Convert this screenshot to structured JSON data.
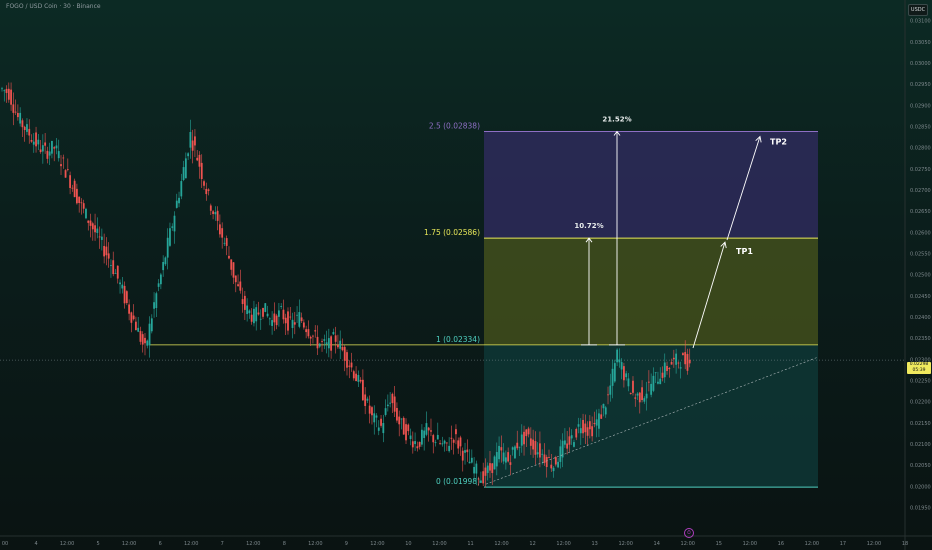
{
  "header": {
    "title": "FOGO / USD Coin · 30 · Binance"
  },
  "currency": "USDC",
  "current_price": {
    "value": "0.02298",
    "countdown": "05:39"
  },
  "colors": {
    "up": "#26a69a",
    "down": "#ef5350",
    "fib_top": "#8e6fc4",
    "fib_mid": "#e8e85a",
    "fib_base": "#4fd0c0",
    "zone_top": "#2e2a5a",
    "zone_mid": "#424f1c",
    "zone_low": "#0f3b3a"
  },
  "chart_data": {
    "type": "candlestick",
    "y_axis": {
      "ticks": [
        "0.03100",
        "0.03050",
        "0.03000",
        "0.02950",
        "0.02900",
        "0.02850",
        "0.02800",
        "0.02750",
        "0.02700",
        "0.02650",
        "0.02600",
        "0.02550",
        "0.02500",
        "0.02450",
        "0.02400",
        "0.02350",
        "0.02300",
        "0.02250",
        "0.02200",
        "0.02150",
        "0.02100",
        "0.02050",
        "0.02000",
        "0.01950"
      ],
      "range": [
        0.01925,
        0.03125
      ]
    },
    "x_axis": {
      "ticks": [
        "00",
        "4",
        "12:00",
        "5",
        "12:00",
        "6",
        "12:00",
        "7",
        "12:00",
        "8",
        "12:00",
        "9",
        "12:00",
        "10",
        "12:00",
        "11",
        "12:00",
        "12",
        "12:00",
        "13",
        "12:00",
        "14",
        "12:00",
        "15",
        "12:00",
        "16",
        "12:00",
        "17",
        "12:00",
        "18"
      ]
    },
    "fib_levels": [
      {
        "label": "2.5 (0.02838)",
        "ratio": 2.5,
        "price": 0.02838
      },
      {
        "label": "1.75 (0.02586)",
        "ratio": 1.75,
        "price": 0.02586
      },
      {
        "label": "1 (0.02334)",
        "ratio": 1,
        "price": 0.02334
      },
      {
        "label": "0 (0.01998)",
        "ratio": 0,
        "price": 0.01998
      }
    ],
    "measurements": [
      {
        "label": "10.72%",
        "from": 0.02334,
        "to": 0.02586
      },
      {
        "label": "21.52%",
        "from": 0.02334,
        "to": 0.02838
      }
    ],
    "targets": [
      {
        "label": "TP1",
        "price": 0.02586
      },
      {
        "label": "TP2",
        "price": 0.02838
      }
    ],
    "price_path": [
      0.0294,
      0.0293,
      0.0287,
      0.0284,
      0.0281,
      0.0279,
      0.028,
      0.0276,
      0.0271,
      0.0266,
      0.0262,
      0.0258,
      0.0254,
      0.0249,
      0.0243,
      0.0238,
      0.0232,
      0.0243,
      0.0252,
      0.0262,
      0.0272,
      0.0283,
      0.0276,
      0.0268,
      0.0262,
      0.0256,
      0.0248,
      0.0242,
      0.024,
      0.0242,
      0.0239,
      0.0241,
      0.0238,
      0.024,
      0.0237,
      0.0234,
      0.0233,
      0.0235,
      0.0231,
      0.0227,
      0.0222,
      0.0216,
      0.0214,
      0.0221,
      0.0215,
      0.0212,
      0.021,
      0.0213,
      0.0211,
      0.0209,
      0.0212,
      0.0208,
      0.0205,
      0.0202,
      0.0204,
      0.0208,
      0.0206,
      0.021,
      0.0212,
      0.0209,
      0.0207,
      0.0205,
      0.0209,
      0.0211,
      0.0215,
      0.0213,
      0.0216,
      0.0221,
      0.0231,
      0.0225,
      0.0221,
      0.0222,
      0.0225,
      0.0227,
      0.0229,
      0.023,
      0.0229
    ]
  }
}
